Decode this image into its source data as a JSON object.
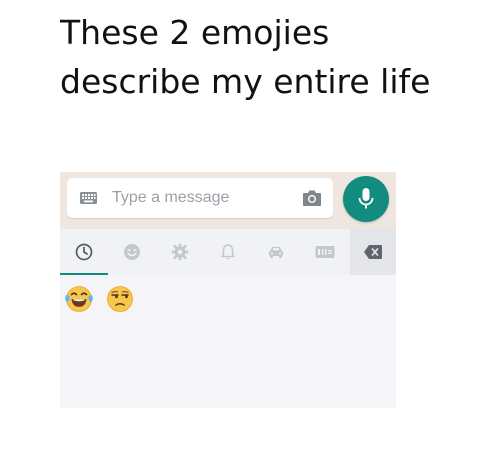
{
  "caption": {
    "text": "These 2 emojies describe my entire life"
  },
  "composer": {
    "placeholder": "Type a message",
    "keyboard_icon": "keyboard-icon",
    "camera_icon": "camera-icon",
    "mic_icon": "microphone-icon",
    "mic_button_color": "#128c7e",
    "background_color": "#efe6df"
  },
  "emoji_tabs": {
    "items": [
      {
        "icon": "recent-clock-icon",
        "active": true
      },
      {
        "icon": "smiley-face-icon",
        "active": false
      },
      {
        "icon": "gear-objects-icon",
        "active": false
      },
      {
        "icon": "bell-icon",
        "active": false
      },
      {
        "icon": "car-icon",
        "active": false
      },
      {
        "icon": "symbols-icon",
        "active": false
      }
    ],
    "backspace_icon": "backspace-icon",
    "accent_color": "#128c7e"
  },
  "recent_emojis": [
    {
      "name": "face-with-tears-of-joy",
      "glyph": "😂"
    },
    {
      "name": "unamused-face",
      "glyph": "😒"
    }
  ]
}
